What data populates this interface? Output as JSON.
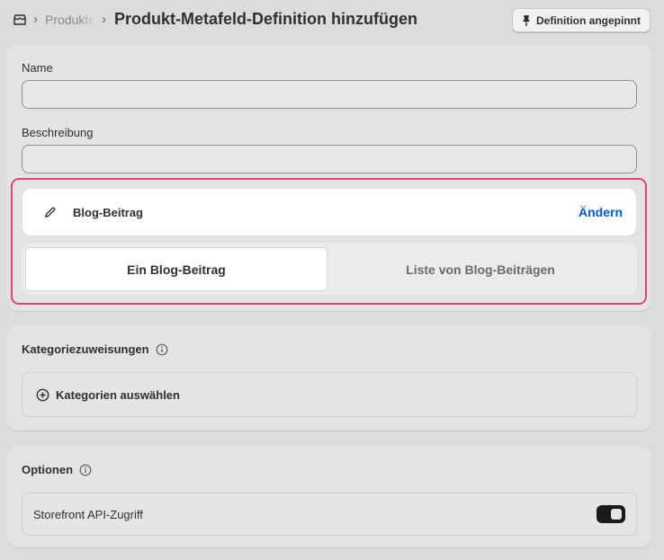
{
  "header": {
    "breadcrumb_parent": "Produkte",
    "breadcrumb_separator": "›",
    "title": "Produkt-Metafeld-Definition hinzufügen",
    "pin_button_label": "Definition angepinnt"
  },
  "form": {
    "name_label": "Name",
    "name_value": "",
    "description_label": "Beschreibung",
    "description_value": ""
  },
  "type_picker": {
    "selected_type": "Blog-Beitrag",
    "change_label": "Ändern",
    "icon": "pencil-icon",
    "options": [
      {
        "label": "Ein Blog-Beitrag",
        "selected": true
      },
      {
        "label": "Liste von Blog-Beiträgen",
        "selected": false
      }
    ],
    "highlight_color": "#e0457b"
  },
  "categories": {
    "title": "Kategoriezuweisungen",
    "select_label": "Kategorien auswählen"
  },
  "options": {
    "title": "Optionen",
    "storefront_label": "Storefront API-Zugriff",
    "storefront_enabled": true
  },
  "colors": {
    "link": "#005bd3",
    "background": "#dcdcdc",
    "toggle_on": "#1a1a1a"
  }
}
